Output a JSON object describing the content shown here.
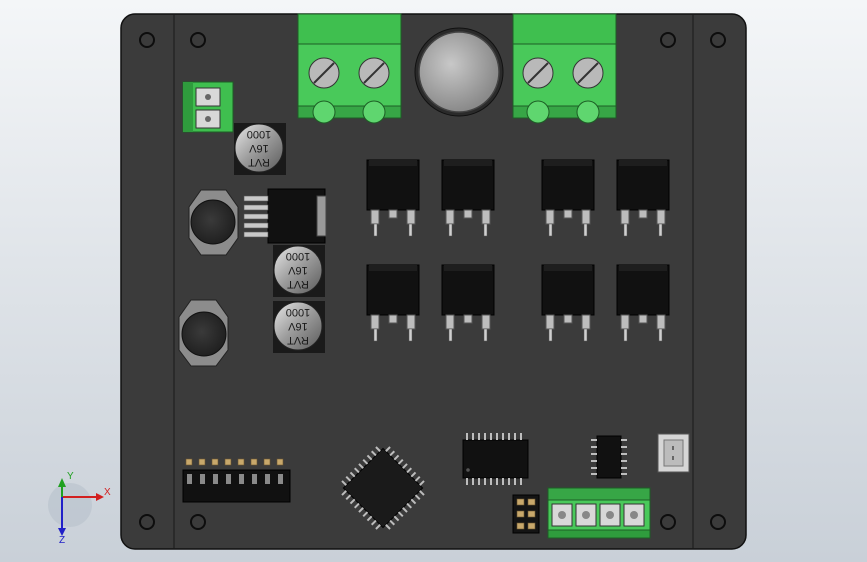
{
  "scene": {
    "background_top": "#f4f6f8",
    "background_bottom": "#c9d0d8",
    "board_color": "#3b3b3b",
    "terminal_color": "#3fbf4f"
  },
  "capacitors": [
    {
      "line1": "RVT",
      "line2": "16V",
      "line3": "1000"
    },
    {
      "line1": "RVT",
      "line2": "16V",
      "line3": "1000"
    },
    {
      "line1": "RVT",
      "line2": "16V",
      "line3": "1000"
    }
  ],
  "axes": {
    "x_label": "X",
    "y_label": "Y",
    "z_label": "Z",
    "x_color": "#d22020",
    "y_color": "#20a020",
    "z_color": "#2020c8"
  }
}
